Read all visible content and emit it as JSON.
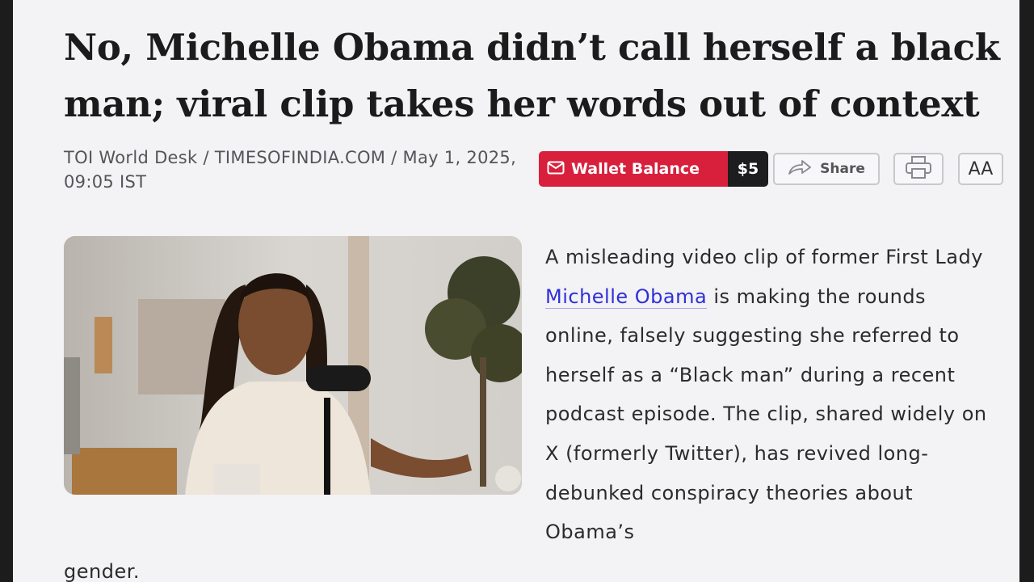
{
  "article": {
    "headline": "No, Michelle Obama didn’t call herself a black man; viral clip takes her words out of context",
    "byline": "TOI World Desk / TIMESOFINDIA.COM / May 1, 2025, 09:05 IST",
    "body_before_link": "A misleading video clip of former First Lady ",
    "body_link": "Michelle Obama",
    "body_after_link": " is making the rounds online, falsely suggesting she referred to herself as a “Black man” during a recent podcast episode. The clip, shared widely on X (formerly Twitter), has revived long-debunked conspiracy theories about Obama’s",
    "body_tail": "gender."
  },
  "toolbar": {
    "wallet_label": "Wallet Balance",
    "wallet_amount": "$5",
    "share_label": "Share",
    "font_size_label": "AA"
  },
  "icons": {
    "wallet": "wallet-icon",
    "share": "share-arrow-icon",
    "print": "printer-icon"
  },
  "colors": {
    "wallet_bg": "#d8203d",
    "wallet_amount_bg": "#1d1d1f",
    "link": "#2f2fd8",
    "page_bg": "#f3f2f4"
  }
}
